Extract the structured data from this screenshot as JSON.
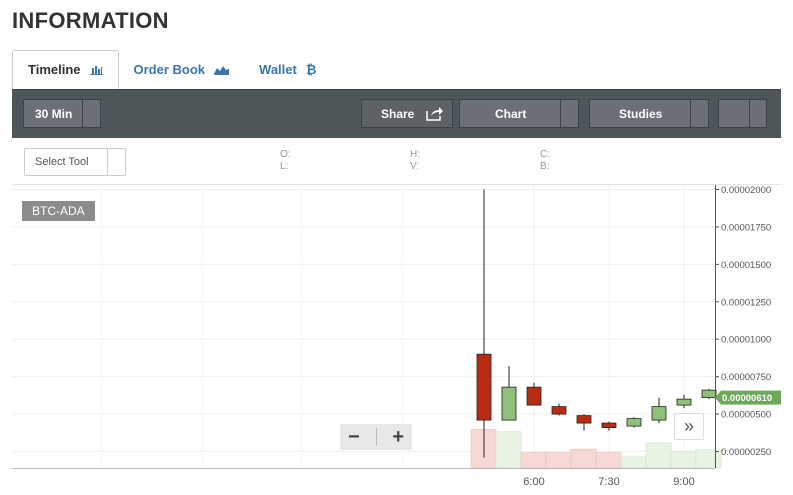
{
  "page": {
    "title": "INFORMATION"
  },
  "tabs": [
    {
      "label": "Timeline",
      "icon": "bar-chart-icon"
    },
    {
      "label": "Order Book",
      "icon": "area-chart-icon"
    },
    {
      "label": "Wallet",
      "icon": "bitcoin-icon"
    }
  ],
  "toolbar": {
    "interval_label": "30 Min",
    "share_label": "Share",
    "chart_label": "Chart",
    "studies_label": "Studies"
  },
  "subbar": {
    "select_tool_label": "Select Tool",
    "ohlc": {
      "o": "O:",
      "h": "H:",
      "c": "C:",
      "l": "L:",
      "v": "V:",
      "b": "B:"
    }
  },
  "colors": {
    "up": "#8fc07a",
    "down": "#b92c14",
    "price_tag": "#6ea85a",
    "toolbar": "#4f565a",
    "link": "#3a76a8"
  },
  "chart_data": {
    "type": "candlestick",
    "symbol": "BTC-ADA",
    "y_tick_labels": [
      "0.00002000",
      "0.00001750",
      "0.00001500",
      "0.00001250",
      "0.00001000",
      "0.00000750",
      "0.00000500",
      "0.00000250"
    ],
    "y_ticks": [
      2e-05,
      1.75e-05,
      1.5e-05,
      1.25e-05,
      1e-05,
      7.5e-06,
      5e-06,
      2.5e-06
    ],
    "ylim": [
      1.4e-06,
      2.03e-05
    ],
    "x_tick_labels": [
      "6:00",
      "7:30",
      "9:00"
    ],
    "last_price_label": "0.00000610",
    "last_price": 6.1e-06,
    "candles": [
      {
        "open": 9e-06,
        "close": 4.6e-06,
        "high": 2e-05,
        "low": 2.1e-06,
        "volume": 0.55
      },
      {
        "open": 4.6e-06,
        "close": 6.8e-06,
        "high": 8.2e-06,
        "low": 4.6e-06,
        "volume": 0.52
      },
      {
        "open": 6.8e-06,
        "close": 5.6e-06,
        "high": 7.1e-06,
        "low": 5.6e-06,
        "volume": 0.22
      },
      {
        "open": 5.5e-06,
        "close": 5e-06,
        "high": 5.7e-06,
        "low": 4.9e-06,
        "volume": 0.22
      },
      {
        "open": 4.9e-06,
        "close": 4.4e-06,
        "high": 5e-06,
        "low": 3.9e-06,
        "volume": 0.27
      },
      {
        "open": 4.4e-06,
        "close": 4.1e-06,
        "high": 4.5e-06,
        "low": 3.9e-06,
        "volume": 0.22
      },
      {
        "open": 4.2e-06,
        "close": 4.7e-06,
        "high": 4.8e-06,
        "low": 4.1e-06,
        "volume": 0.16
      },
      {
        "open": 4.6e-06,
        "close": 5.5e-06,
        "high": 6.1e-06,
        "low": 4.4e-06,
        "volume": 0.36
      },
      {
        "open": 5.6e-06,
        "close": 6e-06,
        "high": 6.3e-06,
        "low": 5.4e-06,
        "volume": 0.24
      },
      {
        "open": 6.1e-06,
        "close": 6.6e-06,
        "high": 6.7e-06,
        "low": 6e-06,
        "volume": 0.26
      }
    ]
  }
}
